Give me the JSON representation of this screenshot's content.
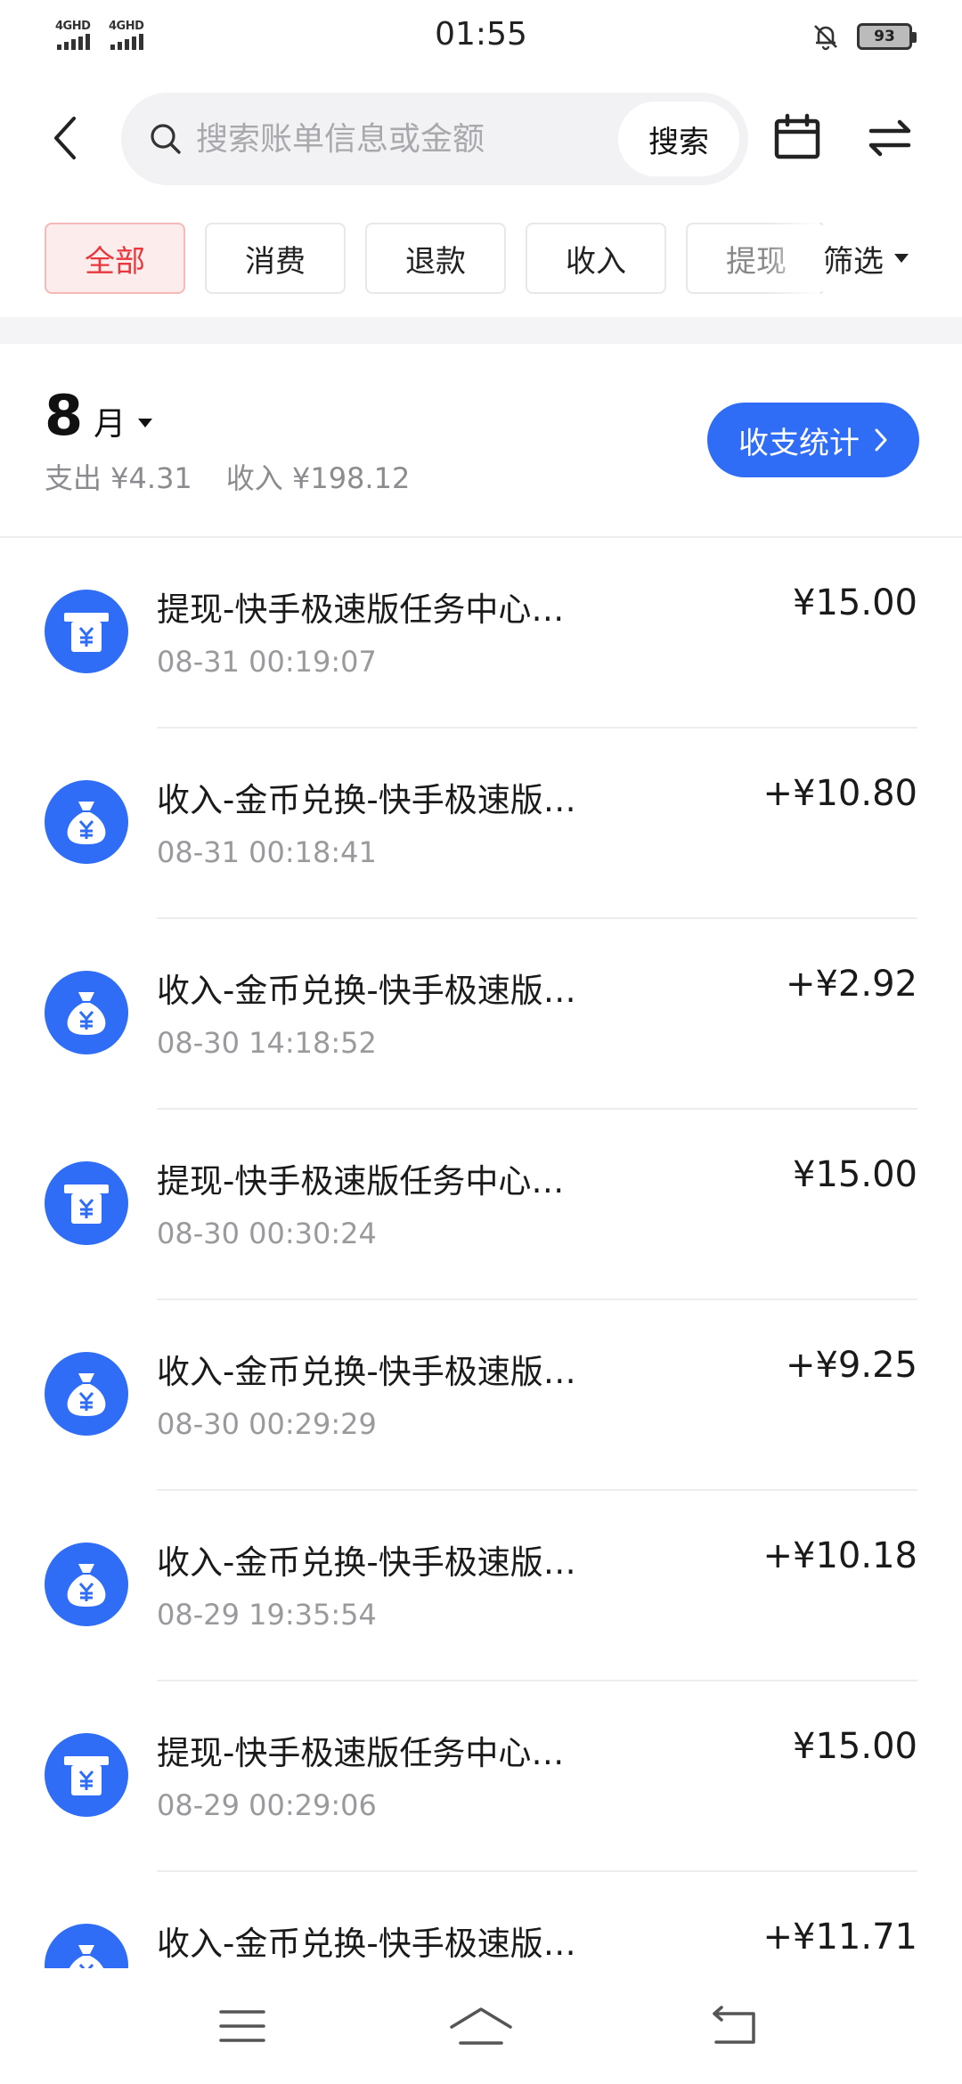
{
  "status_bar": {
    "time": "01:55",
    "network_1": "4GHD",
    "network_2": "4GHD",
    "battery": "93",
    "icons": [
      "signal-icon",
      "bell-off-icon",
      "battery-icon"
    ]
  },
  "header": {
    "search_placeholder": "搜索账单信息或金额",
    "search_button": "搜索",
    "icons": [
      "back-icon",
      "search-icon",
      "calendar-icon",
      "switch-icon"
    ]
  },
  "filters": {
    "chips": [
      "全部",
      "消费",
      "退款",
      "收入",
      "提现"
    ],
    "active_index": 0,
    "filter_label": "筛选"
  },
  "month": {
    "number": "8",
    "unit": "月",
    "expense": "支出 ¥4.31",
    "income": "收入 ¥198.12",
    "stats_button": "收支统计"
  },
  "transactions": [
    {
      "title": "提现-快手极速版任务中心…",
      "time": "08-31 00:19:07",
      "amount": "¥15.00",
      "icon": "atm-withdraw-icon"
    },
    {
      "title": "收入-金币兑换-快手极速版…",
      "time": "08-31 00:18:41",
      "amount": "+¥10.80",
      "icon": "money-bag-icon"
    },
    {
      "title": "收入-金币兑换-快手极速版…",
      "time": "08-30 14:18:52",
      "amount": "+¥2.92",
      "icon": "money-bag-icon"
    },
    {
      "title": "提现-快手极速版任务中心…",
      "time": "08-30 00:30:24",
      "amount": "¥15.00",
      "icon": "atm-withdraw-icon"
    },
    {
      "title": "收入-金币兑换-快手极速版…",
      "time": "08-30 00:29:29",
      "amount": "+¥9.25",
      "icon": "money-bag-icon"
    },
    {
      "title": "收入-金币兑换-快手极速版…",
      "time": "08-29 19:35:54",
      "amount": "+¥10.18",
      "icon": "money-bag-icon"
    },
    {
      "title": "提现-快手极速版任务中心…",
      "time": "08-29 00:29:06",
      "amount": "¥15.00",
      "icon": "atm-withdraw-icon"
    },
    {
      "title": "收入-金币兑换-快手极速版…",
      "time": "",
      "amount": "+¥11.71",
      "icon": "money-bag-icon"
    }
  ],
  "colors": {
    "accent_blue": "#2f6df6",
    "active_red": "#e8383d",
    "active_chip_bg": "#fdecec"
  },
  "navbar": {
    "icons": [
      "menu-icon",
      "home-icon",
      "back-nav-icon"
    ]
  }
}
